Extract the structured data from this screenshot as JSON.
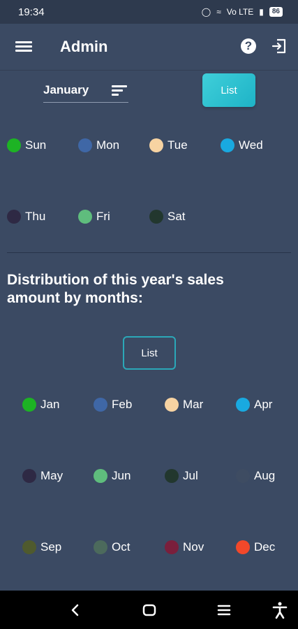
{
  "status": {
    "time": "19:34",
    "network": "Vo LTE",
    "battery": "86"
  },
  "app_bar": {
    "title": "Admin"
  },
  "filter": {
    "month": "January",
    "list_button": "List"
  },
  "weekdays": [
    {
      "label": "Sun",
      "color": "#1db324"
    },
    {
      "label": "Mon",
      "color": "#3f67a6"
    },
    {
      "label": "Tue",
      "color": "#f7d3a2"
    },
    {
      "label": "Wed",
      "color": "#19a9e0"
    },
    {
      "label": "Thu",
      "color": "#2e2944"
    },
    {
      "label": "Fri",
      "color": "#5fbd7d"
    },
    {
      "label": "Sat",
      "color": "#22372e"
    }
  ],
  "sales_section": {
    "title": "Distribution of this year's sales amount by months:",
    "list_button": "List"
  },
  "months": [
    {
      "label": "Jan",
      "color": "#1db324"
    },
    {
      "label": "Feb",
      "color": "#3f67a6"
    },
    {
      "label": "Mar",
      "color": "#f7d3a2"
    },
    {
      "label": "Apr",
      "color": "#19a9e0"
    },
    {
      "label": "May",
      "color": "#2e2944"
    },
    {
      "label": "Jun",
      "color": "#5fbd7d"
    },
    {
      "label": "Jul",
      "color": "#22372e"
    },
    {
      "label": "Aug",
      "color": "#3e4c62"
    },
    {
      "label": "Sep",
      "color": "#4f5a2e"
    },
    {
      "label": "Oct",
      "color": "#4c6a5c"
    },
    {
      "label": "Nov",
      "color": "#7a1f3c"
    },
    {
      "label": "Dec",
      "color": "#f2482a"
    }
  ]
}
